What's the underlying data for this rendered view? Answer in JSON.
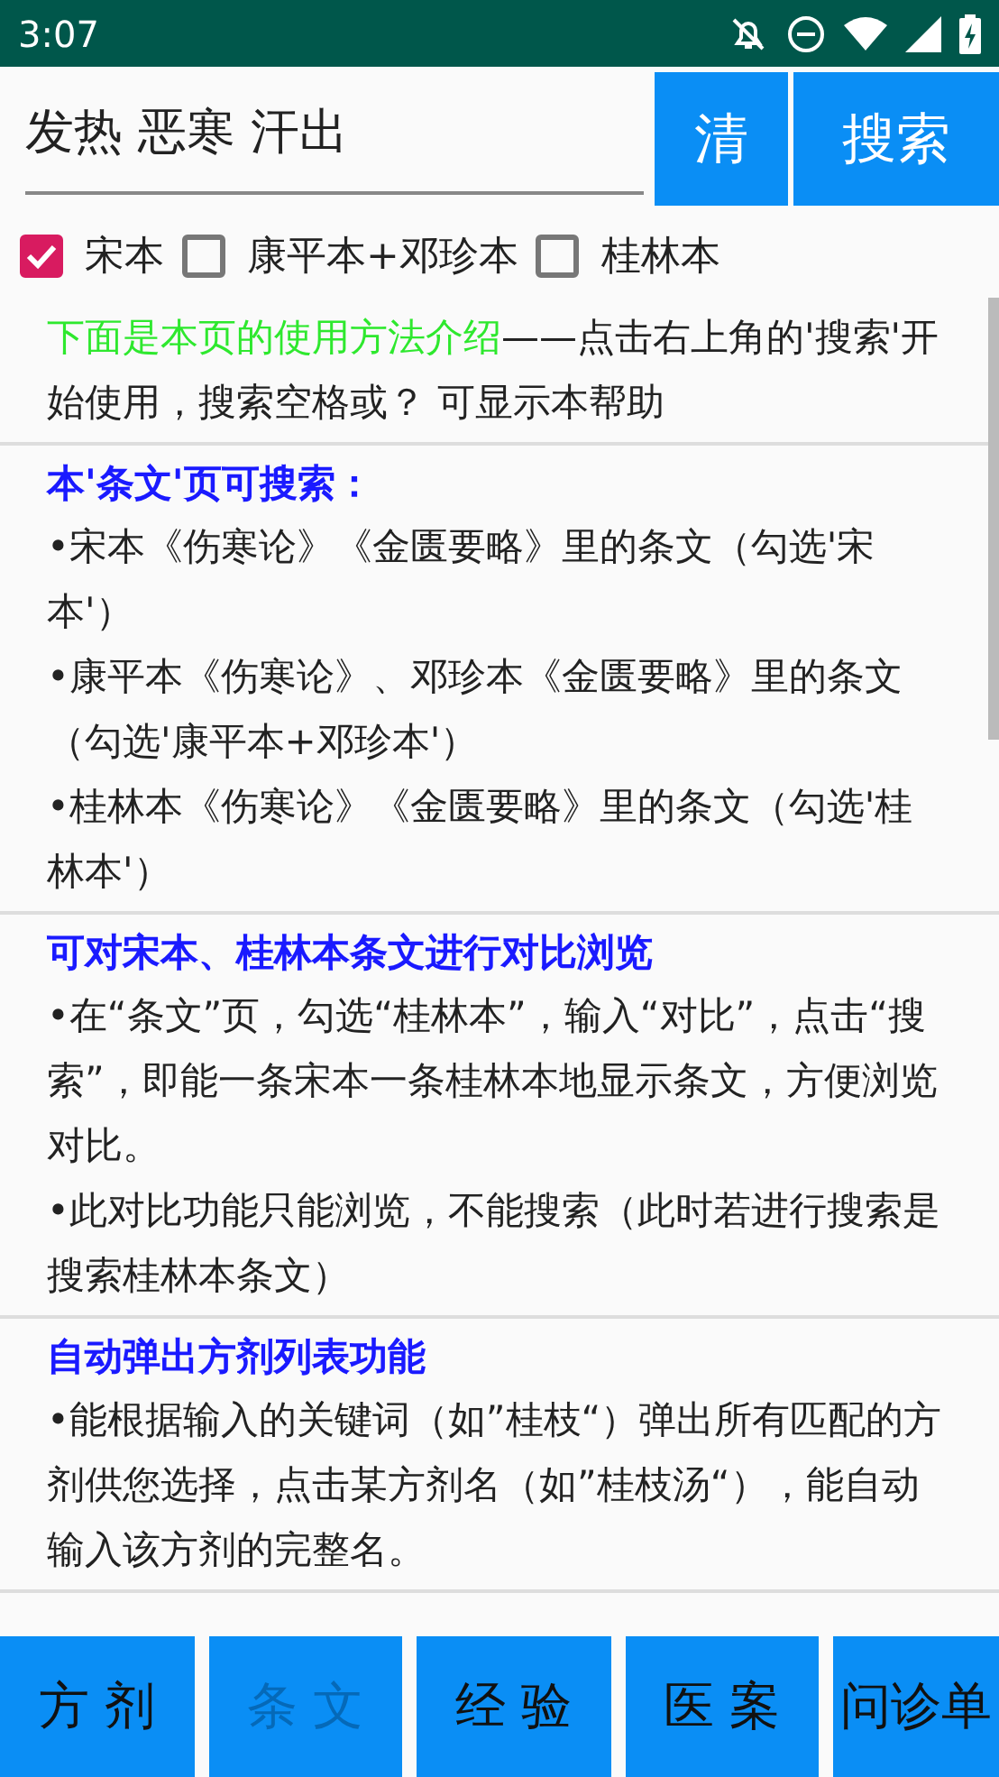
{
  "status_bar": {
    "time": "3:07"
  },
  "search": {
    "value": "发热 恶寒 汗出"
  },
  "buttons": [
    {
      "label": "清"
    },
    {
      "label": "搜索"
    }
  ],
  "editions": [
    {
      "label": "宋本",
      "checked": true
    },
    {
      "label": "康平本+邓珍本",
      "checked": false
    },
    {
      "label": "桂林本",
      "checked": false
    }
  ],
  "sections": [
    {
      "kind": "intro",
      "lead": "下面是本页的使用方法介绍",
      "paragraphs": [
        "——点击右上角的'搜索'开始使用，搜索空格或？ 可显示本帮助"
      ]
    },
    {
      "kind": "topic",
      "heading": "本'条文'页可搜索：",
      "paragraphs": [
        "•宋本《伤寒论》《金匮要略》里的条文（勾选'宋本'）",
        "•康平本《伤寒论》、邓珍本《金匮要略》里的条文（勾选'康平本+邓珍本'）",
        "•桂林本《伤寒论》《金匮要略》里的条文（勾选'桂林本'）"
      ]
    },
    {
      "kind": "topic",
      "heading": "可对宋本、桂林本条文进行对比浏览",
      "paragraphs": [
        "•在“条文”页，勾选“桂林本”，输入“对比”，点击“搜索”，即能一条宋本一条桂林本地显示条文，方便浏览对比。",
        "•此对比功能只能浏览，不能搜索（此时若进行搜索是搜索桂林本条文）"
      ]
    },
    {
      "kind": "topic",
      "heading": "自动弹出方剂列表功能",
      "paragraphs": [
        "•能根据输入的关键词（如”桂枝“）弹出所有匹配的方剂供您选择，点击某方剂名（如”桂枝汤“），能自动输入该方剂的完整名。"
      ]
    }
  ],
  "nav": [
    {
      "label": "方 剂",
      "selected": false
    },
    {
      "label": "条 文",
      "selected": true
    },
    {
      "label": "经 验",
      "selected": false
    },
    {
      "label": "医 案",
      "selected": false
    },
    {
      "label": "问诊单",
      "selected": false
    }
  ]
}
